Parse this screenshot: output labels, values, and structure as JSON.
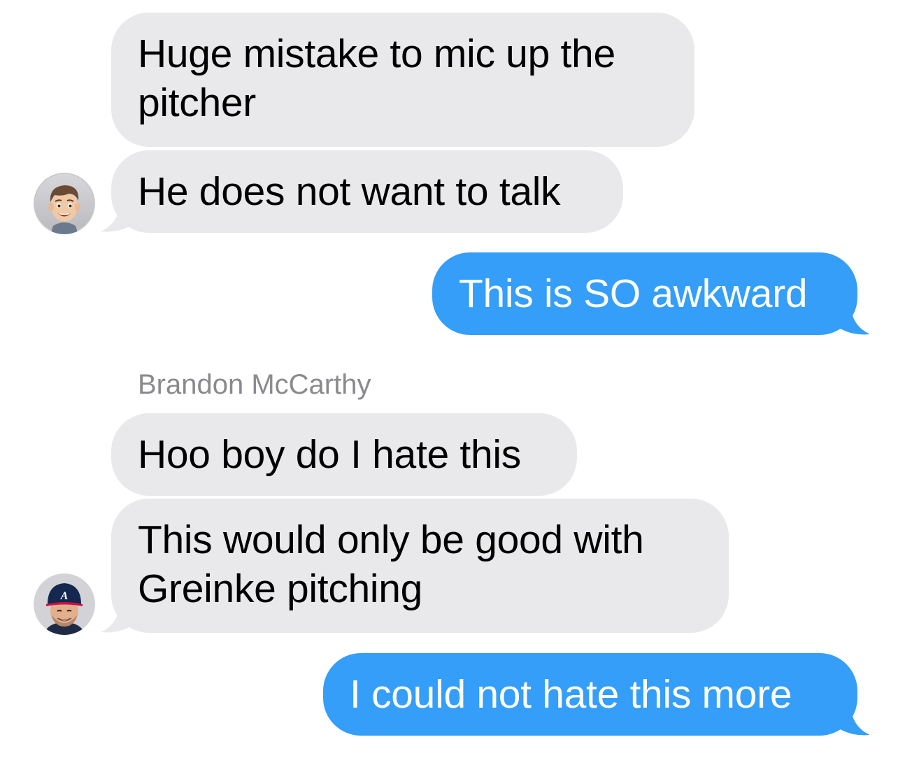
{
  "conversation": {
    "messages": [
      {
        "direction": "incoming",
        "text": "Huge mistake to mic up the\npitcher"
      },
      {
        "direction": "incoming",
        "text": "He does not want to talk"
      },
      {
        "direction": "outgoing",
        "text": "This is SO awkward"
      },
      {
        "direction": "incoming",
        "text": "Hoo boy do I hate this"
      },
      {
        "direction": "incoming",
        "text": "This would only be good with\nGreinke pitching"
      },
      {
        "direction": "outgoing",
        "text": "I could not hate this more"
      }
    ],
    "sender_name": "Brandon McCarthy"
  },
  "avatars": {
    "first_sender": "memoji-avatar",
    "second_sender": "braves-player-avatar"
  },
  "colors": {
    "incoming_bubble": "#e9e9eb",
    "outgoing_bubble": "#349ef9",
    "sender_name": "#8a8a8e"
  }
}
